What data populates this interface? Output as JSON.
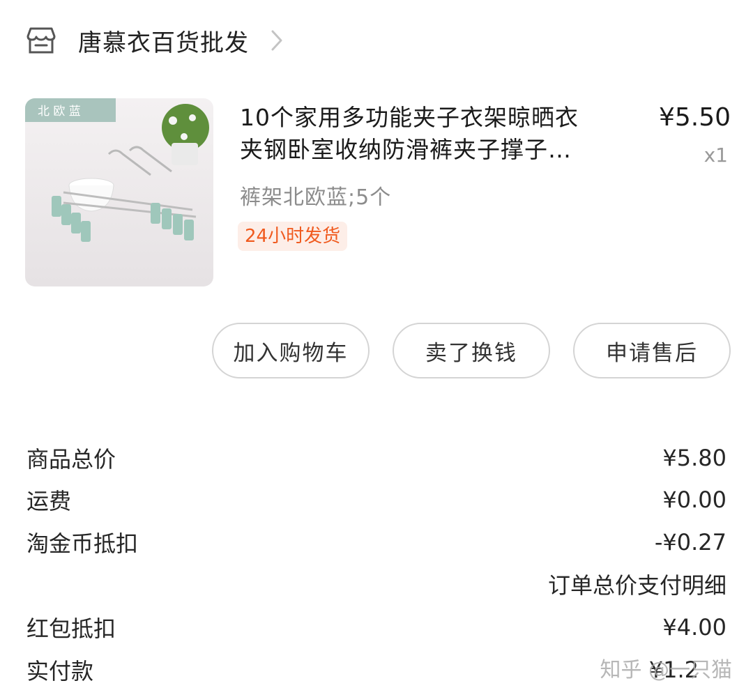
{
  "shop": {
    "name": "唐慕衣百货批发"
  },
  "product": {
    "image_label": "北 欧 蓝",
    "title_line1": "10个家用多功能夹子衣架晾晒衣",
    "title_line2": "夹钢卧室收纳防滑裤夹子撑子…",
    "price": "¥5.50",
    "quantity": "x1",
    "sku": "裤架北欧蓝;5个",
    "badge": "24小时发货"
  },
  "actions": {
    "add_to_cart": "加入购物车",
    "sell_for_cash": "卖了换钱",
    "after_sales": "申请售后"
  },
  "summary": {
    "goods_total_label": "商品总价",
    "goods_total_value": "¥5.80",
    "shipping_label": "运费",
    "shipping_value": "¥0.00",
    "coins_label": "淘金币抵扣",
    "coins_value": "-¥0.27",
    "detail_link": "订单总价支付明细",
    "redpacket_label": "红包抵扣",
    "redpacket_value": "¥4.00",
    "paid_label": "实付款",
    "paid_value": "¥1.2"
  },
  "watermark": "知乎 @一只猫",
  "colors": {
    "badge_text": "#f05a1e",
    "badge_bg": "#fdeee8",
    "product_accent": "#9fc7bb"
  }
}
